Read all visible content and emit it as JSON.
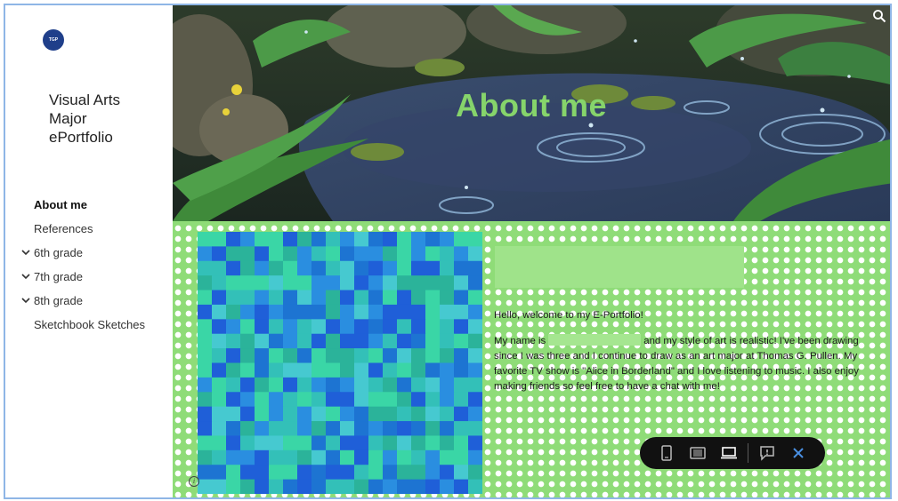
{
  "site": {
    "logo_text": "TGP",
    "title_lines": [
      "Visual Arts",
      "Major",
      "ePortfolio"
    ]
  },
  "nav": {
    "items": [
      {
        "label": "About me",
        "active": true,
        "expandable": false
      },
      {
        "label": "References",
        "active": false,
        "expandable": false
      },
      {
        "label": "6th grade",
        "active": false,
        "expandable": true
      },
      {
        "label": "7th grade",
        "active": false,
        "expandable": true
      },
      {
        "label": "8th grade",
        "active": false,
        "expandable": true
      },
      {
        "label": "Sketchbook Sketches",
        "active": false,
        "expandable": false
      }
    ]
  },
  "hero": {
    "title": "About me"
  },
  "content": {
    "greeting": "Hello, welcome to my E-Portfolio!",
    "bio_before_name": "My name is",
    "bio_after_name": "and my style of art is realistic! I've been drawing since I was three and I continue to draw as an art major at Thomas G. Pullen. My favorite TV show is \"Alice in Borderland\" and I love listening to music. I also enjoy making friends so feel free to have a chat with me!"
  },
  "toolbar": {
    "buttons": [
      "mobile-view-icon",
      "tablet-view-icon",
      "desktop-view-icon",
      "feedback-icon",
      "close-icon"
    ]
  },
  "colors": {
    "accent_green": "#86d46b",
    "dot_background": "#8fdc78",
    "logo_blue": "#1f3f8a",
    "toolbar_bg": "#111111",
    "close_blue": "#4a90e2"
  }
}
